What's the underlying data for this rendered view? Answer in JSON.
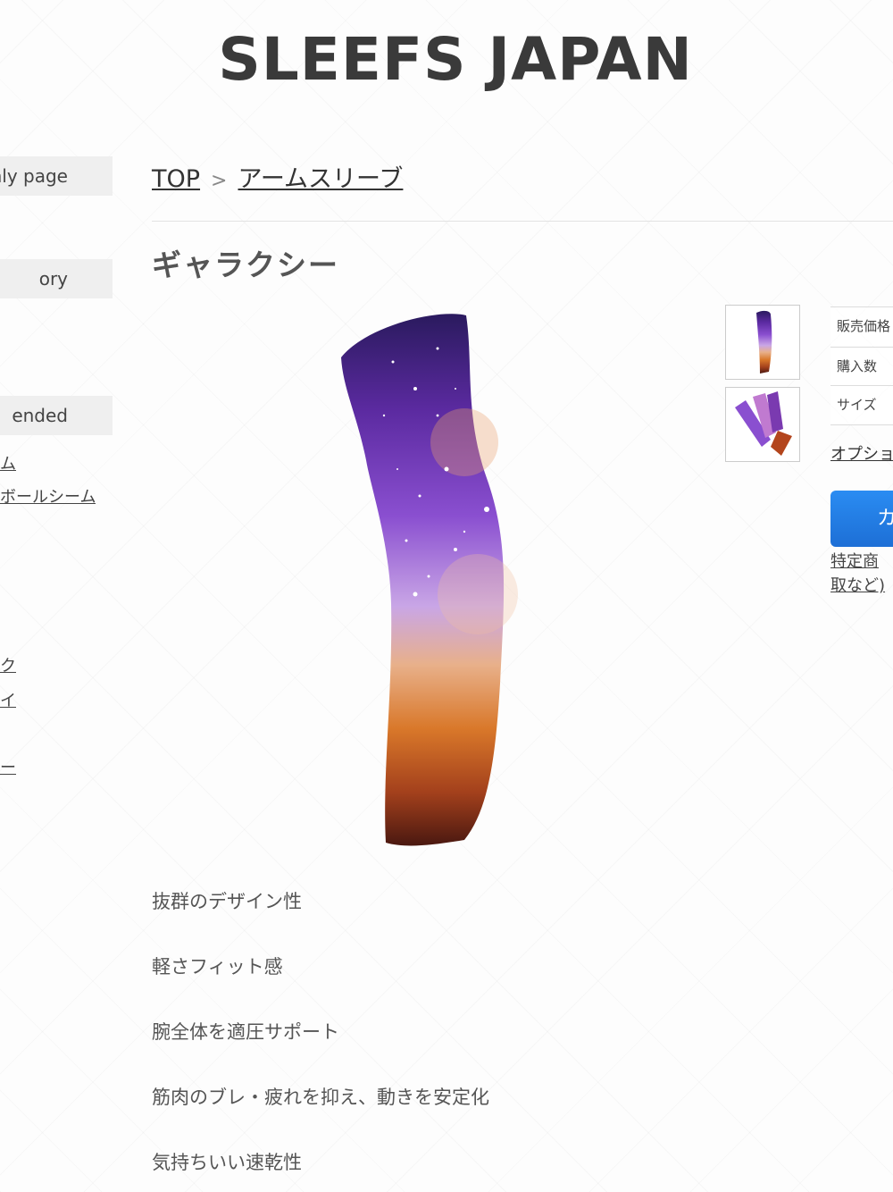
{
  "site": {
    "title": "SLEEFS JAPAN"
  },
  "sidebar": {
    "headings": [
      "nly page",
      "ory",
      "ended"
    ],
    "links": [
      "ム",
      "ボールシーム",
      "ク",
      "イ",
      "ー"
    ]
  },
  "breadcrumb": {
    "home": "TOP",
    "separator": ">",
    "category": "アームスリーブ"
  },
  "product": {
    "title": "ギャラクシー",
    "specs": [
      "販売価格",
      "購入数",
      "サイズ"
    ],
    "option_link": "オプショ",
    "cart_button": "カ",
    "legal_link": "特定商取など)",
    "features": [
      "抜群のデザイン性",
      "軽さフィット感",
      "腕全体を適圧サポート",
      "筋肉のブレ・疲れを抑え、動きを安定化",
      "気持ちいい速乾性"
    ]
  },
  "colors": {
    "accent": "#1d6fd6",
    "sidebar_bg": "#efefef"
  }
}
